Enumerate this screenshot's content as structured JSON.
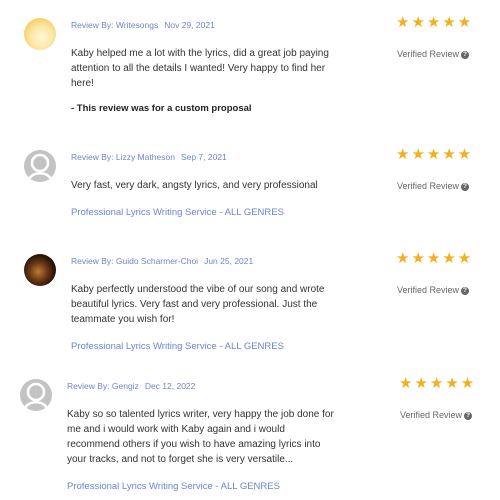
{
  "reviews": [
    {
      "reviewer_label": "Review By: Writesongs",
      "date": "Nov 29, 2021",
      "rating": 5,
      "verified_label": "Verified Review",
      "text": "Kaby helped me a lot with the lyrics, did a great job paying attention to all the details I wanted! Very happy to find her here!",
      "note": "- This review was for a custom proposal",
      "avatar_icon": "avatar-photo"
    },
    {
      "reviewer_label": "Review By: Lizzy Matheson",
      "date": "Sep 7, 2021",
      "rating": 5,
      "verified_label": "Verified Review",
      "text": "Very fast, very dark, angsty lyrics, and very professional",
      "service_link": "Professional Lyrics Writing Service - ALL GENRES",
      "avatar_icon": "user-placeholder-icon"
    },
    {
      "reviewer_label": "Review By: Guido Scharmer-Choi",
      "date": "Jun 25, 2021",
      "rating": 5,
      "verified_label": "Verified Review",
      "text": "Kaby perfectly understood the vibe of our song and wrote beautiful lyrics. Very fast and very professional. Just the teammate you wish for!",
      "service_link": "Professional Lyrics Writing Service - ALL GENRES",
      "avatar_icon": "avatar-photo"
    },
    {
      "reviewer_label": "Review By: Gengiz",
      "date": "Dec 12, 2022",
      "rating": 5,
      "verified_label": "Verified Review",
      "text": "Kaby so so talented lyrics writer, very happy the job done for me and i would work with Kaby again and i would recommend others if you wish to have amazing lyrics into your tracks, and not to forget she is very versatile...",
      "service_link": "Professional Lyrics Writing Service - ALL GENRES",
      "avatar_icon": "user-placeholder-icon"
    }
  ],
  "star_glyph": "★★★★★",
  "help_glyph": "?",
  "colors": {
    "star": "#f2b01e",
    "link": "#6a84d6",
    "meta": "#6f86c8"
  }
}
